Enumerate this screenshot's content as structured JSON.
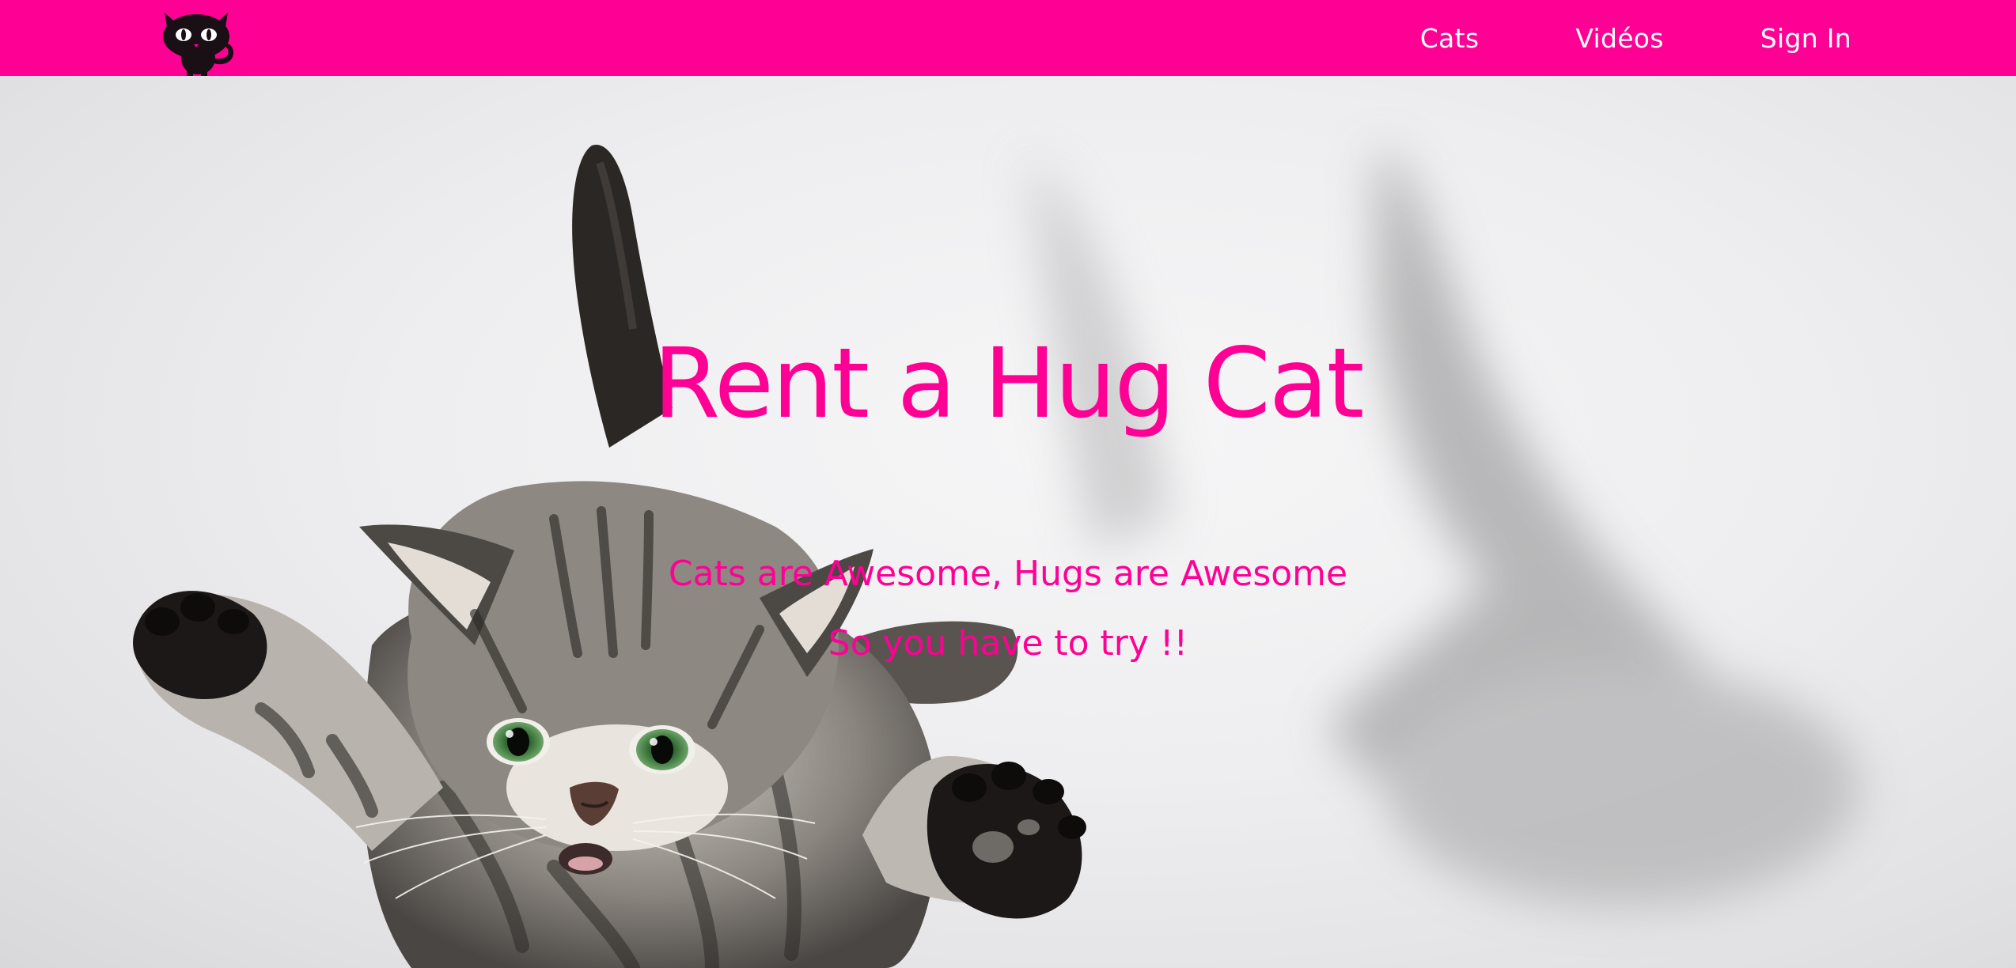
{
  "colors": {
    "brand": "#ff0095",
    "nav_text": "#ffffff",
    "hero_text": "#ff0095"
  },
  "navbar": {
    "logo_icon": "black-cat-logo-icon",
    "links": [
      {
        "label": "Cats"
      },
      {
        "label": "Vidéos"
      },
      {
        "label": "Sign In"
      }
    ]
  },
  "hero": {
    "background_image": "flying-kitten-photo",
    "title": "Rent a Hug Cat",
    "subtitle_1": "Cats are Awesome, Hugs are Awesome",
    "subtitle_2": "So you have to try !!"
  }
}
